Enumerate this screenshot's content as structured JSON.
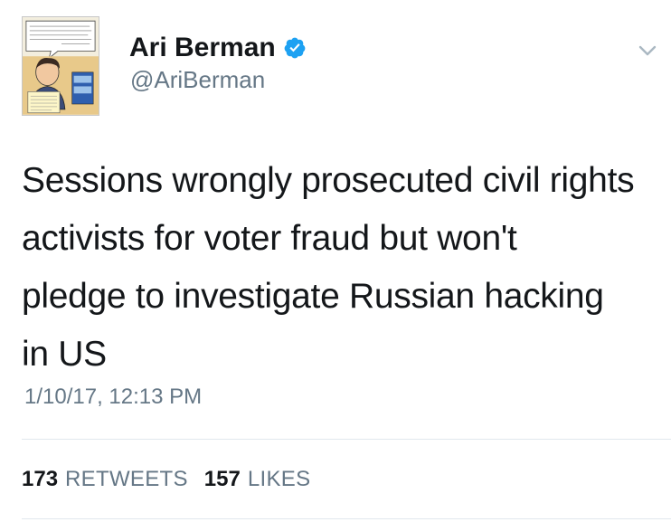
{
  "author": {
    "display_name": "Ari Berman",
    "handle": "@AriBerman",
    "verified": true,
    "avatar_icon": "comic-portrait-avatar"
  },
  "tweet": {
    "text": "Sessions wrongly prosecuted civil rights\nactivists for voter fraud but won't\npledge to investigate Russian hacking\nin US",
    "timestamp": "1/10/17, 12:13 PM"
  },
  "stats": {
    "retweets_count": "173",
    "retweets_label": "RETWEETS",
    "likes_count": "157",
    "likes_label": "LIKES"
  },
  "icons": {
    "verified": "verified-badge-icon",
    "menu": "chevron-down-icon"
  },
  "colors": {
    "text": "#14171a",
    "secondary": "#657786",
    "verified_blue": "#1da1f2",
    "divider": "#e1e8ed"
  }
}
